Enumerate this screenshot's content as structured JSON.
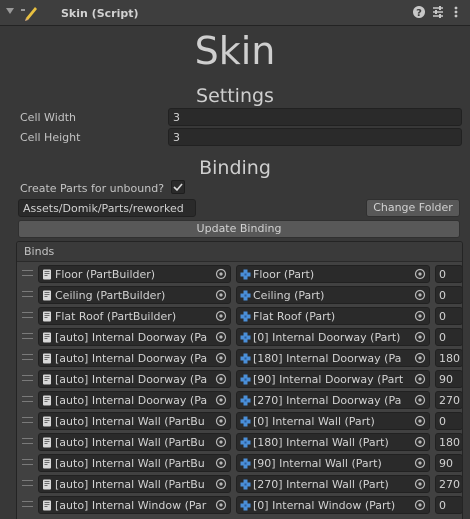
{
  "header": {
    "title": "Skin (Script)",
    "icons": [
      "help-icon",
      "preset-icon",
      "more-icon"
    ]
  },
  "main_title": "Skin",
  "settings": {
    "heading": "Settings",
    "cell_width_label": "Cell Width",
    "cell_width_value": "3",
    "cell_height_label": "Cell Height",
    "cell_height_value": "3"
  },
  "binding": {
    "heading": "Binding",
    "create_parts_label": "Create Parts for unbound?",
    "create_parts_checked": true,
    "path_value": "Assets/Domik/Parts/reworked",
    "change_folder_label": "Change Folder",
    "update_binding_label": "Update Binding"
  },
  "binds": {
    "header": "Binds",
    "rows": [
      {
        "builder": "Floor (PartBuilder)",
        "part": "Floor (Part)",
        "value": "0"
      },
      {
        "builder": "Ceiling (PartBuilder)",
        "part": "Ceiling (Part)",
        "value": "0"
      },
      {
        "builder": "Flat Roof (PartBuilder)",
        "part": "Flat Roof (Part)",
        "value": "0"
      },
      {
        "builder": "[auto] Internal Doorway (Pa",
        "part": "[0] Internal Doorway (Part)",
        "value": "0"
      },
      {
        "builder": "[auto] Internal Doorway (Pa",
        "part": "[180] Internal Doorway (Pa",
        "value": "180"
      },
      {
        "builder": "[auto] Internal Doorway (Pa",
        "part": "[90] Internal Doorway (Part",
        "value": "90"
      },
      {
        "builder": "[auto] Internal Doorway (Pa",
        "part": "[270] Internal Doorway (Pa",
        "value": "270"
      },
      {
        "builder": "[auto] Internal Wall (PartBu",
        "part": "[0] Internal Wall (Part)",
        "value": "0"
      },
      {
        "builder": "[auto] Internal Wall (PartBu",
        "part": "[180] Internal Wall (Part)",
        "value": "180"
      },
      {
        "builder": "[auto] Internal Wall (PartBu",
        "part": "[90] Internal Wall (Part)",
        "value": "90"
      },
      {
        "builder": "[auto] Internal Wall (PartBu",
        "part": "[270] Internal Wall (Part)",
        "value": "270"
      },
      {
        "builder": "[auto] Internal Window (Par",
        "part": "[0] Internal Window (Part)",
        "value": "0"
      }
    ]
  },
  "colors": {
    "background": "#383838",
    "field": "#2a2a2a",
    "button": "#585858",
    "part_icon": "#4a8fd8",
    "builder_icon": "#d8d8d8"
  }
}
